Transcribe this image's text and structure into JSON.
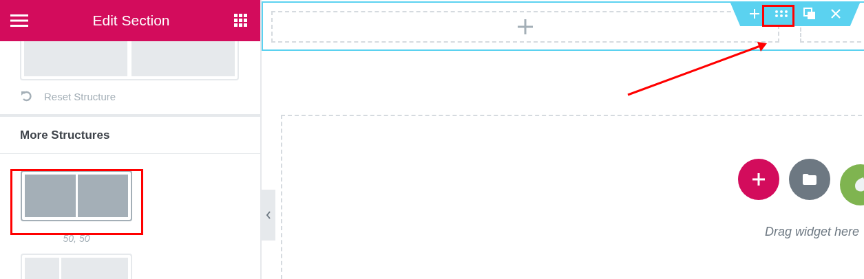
{
  "panel": {
    "title": "Edit Section",
    "reset_label": "Reset Structure",
    "more_title": "More Structures",
    "structures": [
      {
        "label": "50, 50"
      }
    ]
  },
  "canvas": {
    "drop_hint": "Drag widget here"
  }
}
